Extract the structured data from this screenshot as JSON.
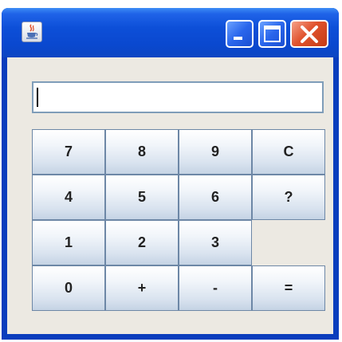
{
  "window": {
    "title": "",
    "icon": "java-coffee-icon",
    "controls": {
      "minimize_icon": "minimize-icon",
      "maximize_icon": "maximize-icon",
      "close_icon": "close-icon",
      "close_color": "#e0522d",
      "titlebar_color": "#0d4fd8"
    }
  },
  "display": {
    "value": ""
  },
  "keypad": {
    "rows": [
      [
        "7",
        "8",
        "9",
        "C"
      ],
      [
        "4",
        "5",
        "6",
        "?"
      ],
      [
        "1",
        "2",
        "3"
      ],
      [
        "0",
        "+",
        "-",
        "="
      ]
    ]
  }
}
